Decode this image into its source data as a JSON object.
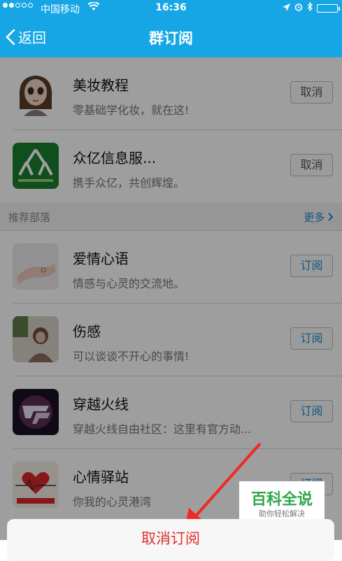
{
  "status_bar": {
    "carrier": "中国移动",
    "time": "16:36"
  },
  "nav": {
    "back_label": "返回",
    "title": "群订阅"
  },
  "subscribed": [
    {
      "title": "美妆教程",
      "subtitle": "零基础学化妆，就在这!",
      "button": "取消",
      "icon": "cartoon-girl-avatar"
    },
    {
      "title": "众亿信息服...",
      "subtitle": "携手众亿，共创辉煌。",
      "button": "取消",
      "icon": "zhongyi-logo"
    }
  ],
  "section": {
    "label": "推荐部落",
    "more": "更多"
  },
  "recommended": [
    {
      "title": "爱情心语",
      "subtitle": "情感与心灵的交流地。",
      "button": "订阅",
      "icon": "hand-ring-photo"
    },
    {
      "title": "伤感",
      "subtitle": "可以谈谈不开心的事情!",
      "button": "订阅",
      "icon": "woman-photo"
    },
    {
      "title": "穿越火线",
      "subtitle": "穿越火线自由社区：这里有官方动...",
      "button": "订阅",
      "icon": "cf-logo"
    },
    {
      "title": "心情驿站",
      "subtitle": "你我的心灵港湾",
      "button": "订阅",
      "icon": "heart-logo"
    }
  ],
  "action_sheet": {
    "label": "取消订阅"
  },
  "watermark": {
    "title": "百科全说",
    "subtitle": "助你轻松解决"
  },
  "colors": {
    "nav_blue": "#16a6e6",
    "link_blue": "#1a8bd0",
    "destructive_red": "#e0312c",
    "watermark_green": "#30a74a"
  }
}
